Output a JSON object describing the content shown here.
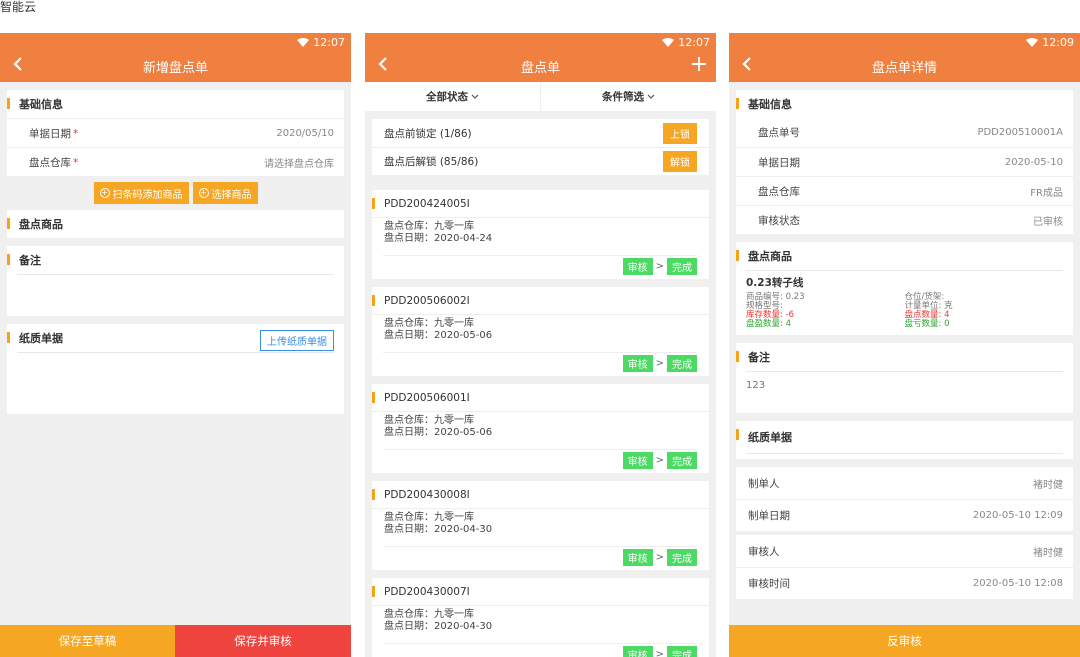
{
  "page_label": "智能云",
  "colors": {
    "header": "#f08040",
    "accent": "#f5a623",
    "danger": "#f0443f",
    "success": "#4cd964",
    "link": "#3a8ee6"
  },
  "screen1": {
    "time": "12:07",
    "title": "新增盘点单",
    "basic_section": "基础信息",
    "fields": [
      {
        "label": "单据日期",
        "value": "2020/05/10"
      },
      {
        "label": "盘点仓库",
        "value": "请选择盘点仓库"
      }
    ],
    "scan_button": "扫条码添加商品",
    "select_button": "选择商品",
    "goods_section": "盘点商品",
    "remark_section": "备注",
    "paper_section": "纸质单据",
    "upload_button": "上传纸质单据",
    "save_draft": "保存至草稿",
    "save_audit": "保存并审核"
  },
  "screen2": {
    "time": "12:07",
    "title": "盘点单",
    "filter_status": "全部状态",
    "filter_condition": "条件筛选",
    "lock_rows": [
      {
        "label": "盘点前锁定 (1/86)",
        "button": "上锁"
      },
      {
        "label": "盘点后解锁 (85/86)",
        "button": "解锁"
      }
    ],
    "orders": [
      {
        "id": "PDD200424005I",
        "warehouse": "盘点仓库：九零一库",
        "date": "盘点日期：2020-04-24",
        "step1": "审核",
        "step2": "完成"
      },
      {
        "id": "PDD200506002I",
        "warehouse": "盘点仓库：九零一库",
        "date": "盘点日期：2020-05-06",
        "step1": "审核",
        "step2": "完成"
      },
      {
        "id": "PDD200506001I",
        "warehouse": "盘点仓库：九零一库",
        "date": "盘点日期：2020-05-06",
        "step1": "审核",
        "step2": "完成"
      },
      {
        "id": "PDD200430008I",
        "warehouse": "盘点仓库：九零一库",
        "date": "盘点日期：2020-04-30",
        "step1": "审核",
        "step2": "完成"
      },
      {
        "id": "PDD200430007I",
        "warehouse": "盘点仓库：九零一库",
        "date": "盘点日期：2020-04-30",
        "step1": "审核",
        "step2": "完成"
      }
    ],
    "arrow": ">"
  },
  "screen3": {
    "time": "12:09",
    "title": "盘点单详情",
    "basic_section": "基础信息",
    "fields": [
      {
        "label": "盘点单号",
        "value": "PDD200510001A"
      },
      {
        "label": "单据日期",
        "value": "2020-05-10"
      },
      {
        "label": "盘点仓库",
        "value": "FR成品"
      },
      {
        "label": "审核状态",
        "value": "已审核"
      }
    ],
    "goods_section": "盘点商品",
    "product": {
      "name": "0.23转子线",
      "code": "商品编号: 0.23",
      "location": "仓位/货架:",
      "spec": "规格型号:",
      "unit": "计量单位: 克",
      "stock": "库存数量: -6",
      "counted": "盘点数量: 4",
      "gain": "盘盈数量: 4",
      "loss": "盘亏数量: 0"
    },
    "remark_section": "备注",
    "remark_text": "123",
    "paper_section": "纸质单据",
    "maker_rows": [
      {
        "label": "制单人",
        "value": "褚时健"
      },
      {
        "label": "制单日期",
        "value": "2020-05-10 12:09"
      }
    ],
    "audit_rows": [
      {
        "label": "审核人",
        "value": "褚时健"
      },
      {
        "label": "审核时间",
        "value": "2020-05-10 12:08"
      }
    ],
    "reverse_button": "反审核"
  }
}
